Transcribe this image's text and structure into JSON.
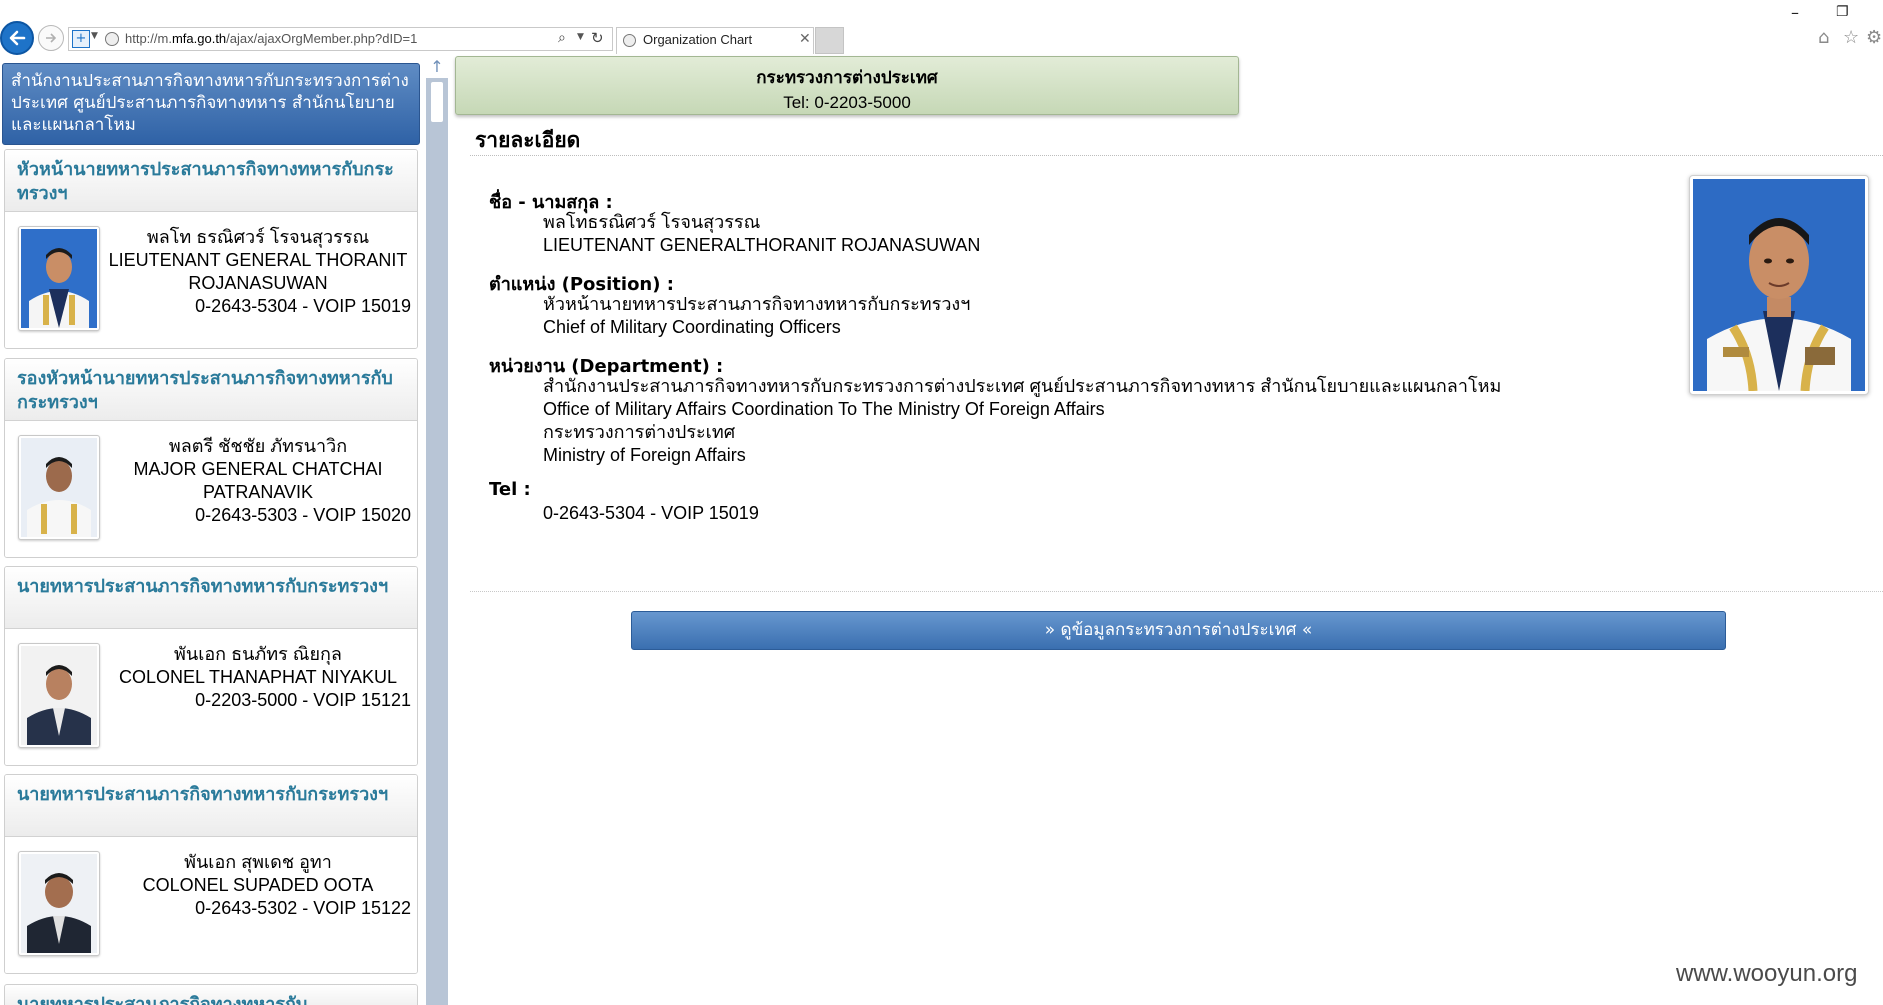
{
  "browser": {
    "url_prefix": "http://m.",
    "url_domain": "mfa.go.th",
    "url_path": "/ajax/ajaxOrgMember.php?dID=1",
    "tab_title": "Organization Chart"
  },
  "sidebar": {
    "header": "สำนักงานประสานภารกิจทางทหารกับกระทรวงการต่างประเทศ ศูนย์ประสานภารกิจทางทหาร สำนักนโยบายและแผนกลาโหม",
    "cards": [
      {
        "title": "หัวหน้านายทหารประสานภารกิจทางทหารกับกระทรวงฯ",
        "name_th": "พลโท ธรณิศวร์ โรจนสุวรรณ",
        "name_en": "LIEUTENANT GENERAL THORANIT ROJANASUWAN",
        "tel": "0-2643-5304 - VOIP 15019"
      },
      {
        "title": "รองหัวหน้านายทหารประสานภารกิจทางทหารกับกระทรวงฯ",
        "name_th": "พลตรี ชัชชัย ภัทรนาวิก",
        "name_en": "MAJOR GENERAL CHATCHAI PATRANAVIK",
        "tel": "0-2643-5303 - VOIP 15020"
      },
      {
        "title": "นายทหารประสานภารกิจทางทหารกับกระทรวงฯ",
        "name_th": "พันเอก ธนภัทร ณิยกุล",
        "name_en": "COLONEL THANAPHAT NIYAKUL",
        "tel": "0-2203-5000 - VOIP 15121"
      },
      {
        "title": "นายทหารประสานภารกิจทางทหารกับกระทรวงฯ",
        "name_th": "พันเอก สุพเดช อูทา",
        "name_en": "COLONEL SUPADED OOTA",
        "tel": "0-2643-5302 - VOIP 15122"
      }
    ],
    "partial_card_title": "นายทหารประสานภารกิจทางทหารกับ"
  },
  "ministry": {
    "name": "กระทรวงการต่างประเทศ",
    "tel": "Tel: 0-2203-5000"
  },
  "details": {
    "title": "รายละเอียด",
    "name_label": "ชื่อ - นามสกุล :",
    "name_th": "พลโทธรณิศวร์ โรจนสุวรรณ",
    "name_en": "LIEUTENANT GENERALTHORANIT ROJANASUWAN",
    "position_label": "ตำแหน่ง (Position) :",
    "position_th": "หัวหน้านายทหารประสานภารกิจทางทหารกับกระทรวงฯ",
    "position_en": "Chief of Military Coordinating Officers",
    "department_label": "หน่วยงาน (Department) :",
    "department_th": "สำนักงานประสานภารกิจทางทหารกับกระทรวงการต่างประเทศ ศูนย์ประสานภารกิจทางทหาร สำนักนโยบายและแผนกลาโหม",
    "department_en": "Office of Military Affairs Coordination To The Ministry Of Foreign Affairs",
    "ministry_th": "กระทรวงการต่างประเทศ",
    "ministry_en": "Ministry of Foreign Affairs",
    "tel_label": "Tel :",
    "tel": "0-2643-5304 - VOIP 15019"
  },
  "button_label": "» ดูข้อมูลกระทรวงการต่างประเทศ «",
  "watermark": "www.wooyun.org",
  "icons": {
    "back": "back-arrow-icon",
    "forward": "forward-arrow-icon",
    "compat": "compatibility-view-icon",
    "search": "search-icon",
    "refresh": "refresh-icon",
    "close": "close-icon",
    "home": "home-icon",
    "favorites": "star-icon",
    "settings": "gear-icon"
  },
  "colors": {
    "sidebar_header": "#2f62a6",
    "card_title": "#2a7a9a",
    "ministry_box": "#c6d8b6",
    "button": "#3a6fb0"
  }
}
